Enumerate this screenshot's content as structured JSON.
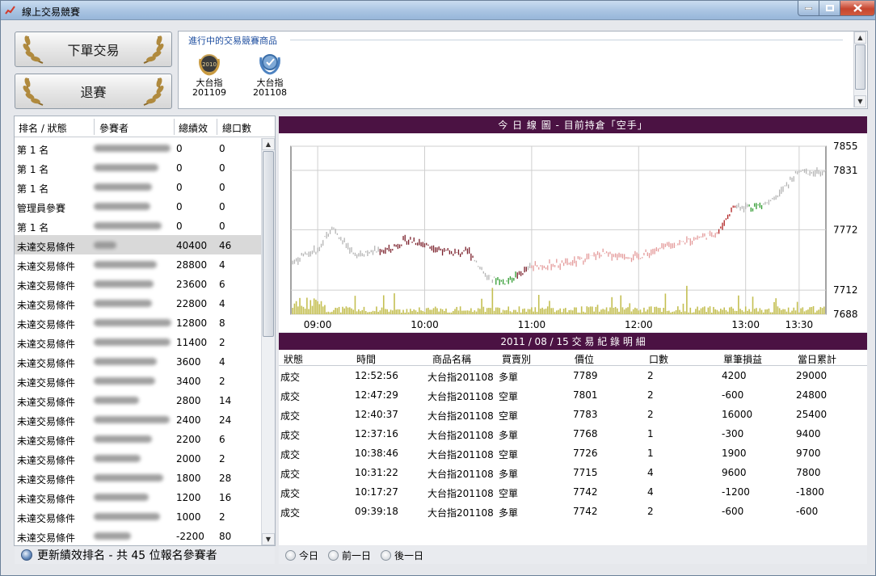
{
  "window": {
    "title": "線上交易競賽"
  },
  "buttons": {
    "order": "下單交易",
    "quit": "退賽"
  },
  "products": {
    "group_label": "進行中的交易競賽商品",
    "items": [
      {
        "name": "大台指",
        "code": "201109",
        "icon": "gold-laurel-medal-icon"
      },
      {
        "name": "大台指",
        "code": "201108",
        "icon": "blue-laurel-medal-icon"
      }
    ]
  },
  "ranking": {
    "headers": [
      "排名 / 狀態",
      "參賽者",
      "總績效",
      "總口數"
    ],
    "rows": [
      {
        "status": "第 1 名",
        "perf": "0",
        "lots": "0"
      },
      {
        "status": "第 1 名",
        "perf": "0",
        "lots": "0"
      },
      {
        "status": "第 1 名",
        "perf": "0",
        "lots": "0"
      },
      {
        "status": "管理員參賽",
        "perf": "0",
        "lots": "0"
      },
      {
        "status": "第 1 名",
        "perf": "0",
        "lots": "0"
      },
      {
        "status": "未達交易條件",
        "perf": "40400",
        "lots": "46",
        "selected": true
      },
      {
        "status": "未達交易條件",
        "perf": "28800",
        "lots": "4"
      },
      {
        "status": "未達交易條件",
        "perf": "23600",
        "lots": "6"
      },
      {
        "status": "未達交易條件",
        "perf": "22800",
        "lots": "4"
      },
      {
        "status": "未達交易條件",
        "perf": "12800",
        "lots": "8"
      },
      {
        "status": "未達交易條件",
        "perf": "11400",
        "lots": "2"
      },
      {
        "status": "未達交易條件",
        "perf": "3600",
        "lots": "4"
      },
      {
        "status": "未達交易條件",
        "perf": "3400",
        "lots": "2"
      },
      {
        "status": "未達交易條件",
        "perf": "2800",
        "lots": "14"
      },
      {
        "status": "未達交易條件",
        "perf": "2400",
        "lots": "24"
      },
      {
        "status": "未達交易條件",
        "perf": "2200",
        "lots": "6"
      },
      {
        "status": "未達交易條件",
        "perf": "2000",
        "lots": "2"
      },
      {
        "status": "未達交易條件",
        "perf": "1800",
        "lots": "28"
      },
      {
        "status": "未達交易條件",
        "perf": "1200",
        "lots": "16"
      },
      {
        "status": "未達交易條件",
        "perf": "1000",
        "lots": "2"
      },
      {
        "status": "未達交易條件",
        "perf": "-2200",
        "lots": "80"
      }
    ],
    "footer": "更新績效排名 - 共 45 位報名參賽者"
  },
  "chart": {
    "title": "今 日 線 圖 - 目前持倉「空手」"
  },
  "chart_data": {
    "type": "line",
    "x_ticks": [
      "09:00",
      "10:00",
      "11:00",
      "12:00",
      "13:00",
      "13:30"
    ],
    "y_ticks": [
      7855,
      7831,
      7772,
      7712,
      7688
    ],
    "ylim": [
      7688,
      7855
    ],
    "grid": true,
    "price_points": [
      {
        "t": "08:45",
        "p": 7740
      },
      {
        "t": "09:00",
        "p": 7752
      },
      {
        "t": "09:08",
        "p": 7775
      },
      {
        "t": "09:20",
        "p": 7748
      },
      {
        "t": "09:40",
        "p": 7752
      },
      {
        "t": "09:50",
        "p": 7762
      },
      {
        "t": "10:00",
        "p": 7758
      },
      {
        "t": "10:15",
        "p": 7748
      },
      {
        "t": "10:25",
        "p": 7750
      },
      {
        "t": "10:35",
        "p": 7725
      },
      {
        "t": "10:45",
        "p": 7720
      },
      {
        "t": "11:00",
        "p": 7735
      },
      {
        "t": "11:20",
        "p": 7738
      },
      {
        "t": "11:40",
        "p": 7748
      },
      {
        "t": "12:00",
        "p": 7745
      },
      {
        "t": "12:15",
        "p": 7755
      },
      {
        "t": "12:30",
        "p": 7762
      },
      {
        "t": "12:45",
        "p": 7770
      },
      {
        "t": "12:53",
        "p": 7795
      },
      {
        "t": "13:05",
        "p": 7795
      },
      {
        "t": "13:15",
        "p": 7800
      },
      {
        "t": "13:30",
        "p": 7830
      },
      {
        "t": "13:45",
        "p": 7828
      }
    ],
    "volume_color": "#c4bf52"
  },
  "trades": {
    "title": "2011 / 08 / 15 交 易 紀 錄 明 細",
    "headers": [
      "狀態",
      "時間",
      "商品名稱",
      "買賣別",
      "價位",
      "口數",
      "單筆損益",
      "當日累計"
    ],
    "rows": [
      [
        "成交",
        "12:52:56",
        "大台指201108",
        "多單",
        "7789",
        "2",
        "4200",
        "29000"
      ],
      [
        "成交",
        "12:47:29",
        "大台指201108",
        "空單",
        "7801",
        "2",
        "-600",
        "24800"
      ],
      [
        "成交",
        "12:40:37",
        "大台指201108",
        "空單",
        "7783",
        "2",
        "16000",
        "25400"
      ],
      [
        "成交",
        "12:37:16",
        "大台指201108",
        "多單",
        "7768",
        "1",
        "-300",
        "9400"
      ],
      [
        "成交",
        "10:38:46",
        "大台指201108",
        "空單",
        "7726",
        "1",
        "1900",
        "9700"
      ],
      [
        "成交",
        "10:31:22",
        "大台指201108",
        "多單",
        "7715",
        "4",
        "9600",
        "7800"
      ],
      [
        "成交",
        "10:17:27",
        "大台指201108",
        "空單",
        "7742",
        "4",
        "-1200",
        "-1800"
      ],
      [
        "成交",
        "09:39:18",
        "大台指201108",
        "多單",
        "7742",
        "2",
        "-600",
        "-600"
      ]
    ]
  },
  "day_options": [
    "今日",
    "前一日",
    "後一日"
  ]
}
